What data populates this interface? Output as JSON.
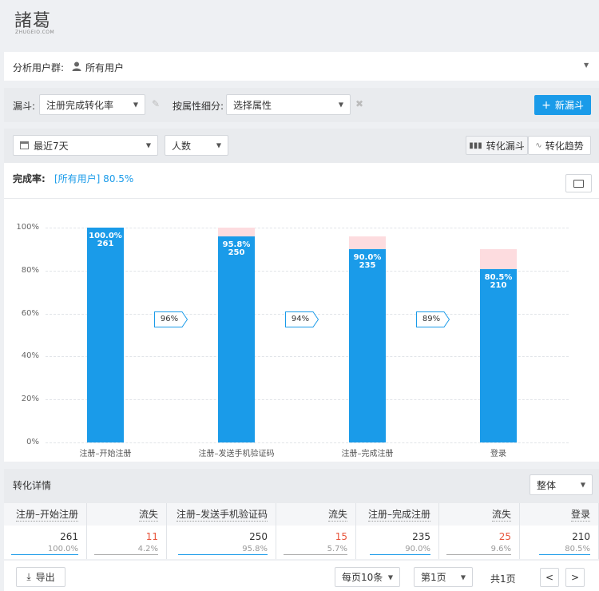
{
  "logo": {
    "main": "諸葛",
    "sub": "ZHUGEIO.COM"
  },
  "user_group": {
    "label": "分析用户群:",
    "value": "所有用户"
  },
  "filters": {
    "funnel_label": "漏斗:",
    "funnel_value": "注册完成转化率",
    "breakdown_label": "按属性细分:",
    "breakdown_value": "选择属性",
    "new_funnel": "新漏斗"
  },
  "controls": {
    "date_range": "最近7天",
    "metric": "人数",
    "view_funnel": "转化漏斗",
    "view_trend": "转化趋势"
  },
  "completion": {
    "label": "完成率:",
    "value": "[所有用户] 80.5%"
  },
  "chart_data": {
    "type": "bar",
    "categories": [
      "注册–开始注册",
      "注册–发送手机验证码",
      "注册–完成注册",
      "登录"
    ],
    "values": [
      100.0,
      95.8,
      90.0,
      80.5
    ],
    "counts": [
      261,
      250,
      235,
      210
    ],
    "previous_step": [
      100.0,
      100.0,
      95.8,
      90.0
    ],
    "step_conversion": [
      "96%",
      "94%",
      "89%"
    ],
    "ylim": [
      0,
      100
    ],
    "yticks": [
      "0%",
      "20%",
      "40%",
      "60%",
      "80%",
      "100%"
    ],
    "colors": {
      "bar": "#1a9be9",
      "loss": "#fddcdf"
    }
  },
  "details": {
    "title": "转化详情",
    "scope": "整体",
    "headers": [
      "注册–开始注册",
      "流失",
      "注册–发送手机验证码",
      "流失",
      "注册–完成注册",
      "流失",
      "登录"
    ],
    "values": [
      "261",
      "11",
      "250",
      "15",
      "235",
      "25",
      "210"
    ],
    "percents": [
      "100.0%",
      "4.2%",
      "95.8%",
      "5.7%",
      "90.0%",
      "9.6%",
      "80.5%"
    ]
  },
  "footer": {
    "export": "导出",
    "page_size": "每页10条",
    "page": "第1页",
    "total": "共1页",
    "prev": "<",
    "next": ">"
  }
}
